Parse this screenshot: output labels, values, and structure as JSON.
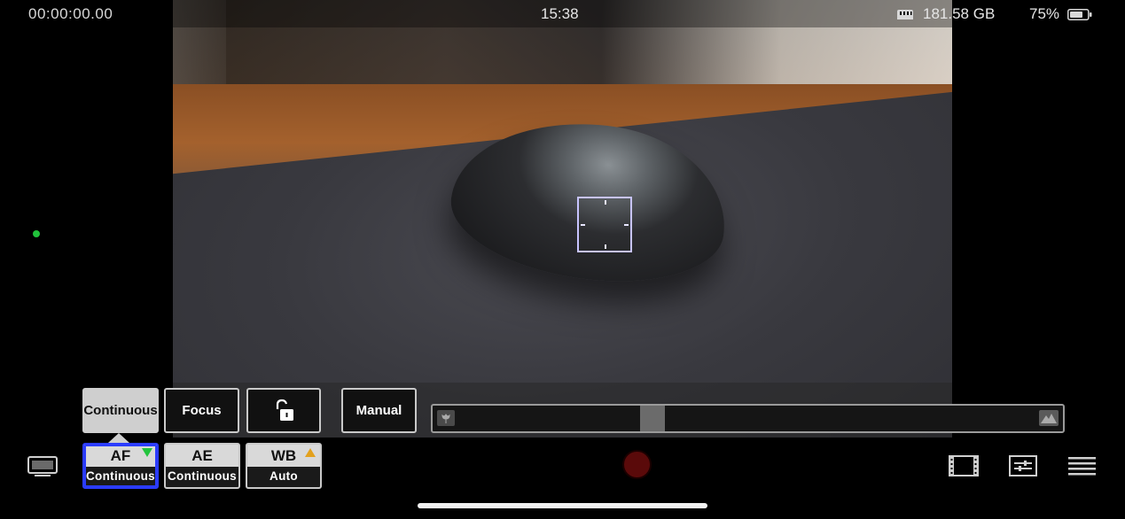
{
  "status": {
    "timecode": "00:00:00.00",
    "clock": "15:38",
    "storage": "181.58 GB",
    "battery": "75%",
    "storage_icon": "sd-card-icon",
    "battery_icon": "battery-icon",
    "battery_level_fraction": 0.75
  },
  "focus_options": {
    "continuous": "Continuous",
    "focus": "Focus",
    "lock_icon": "unlock-icon",
    "manual": "Manual",
    "selected": "Continuous"
  },
  "focus_slider": {
    "left_icon": "macro-flower-icon",
    "right_icon": "mountain-infinity-icon",
    "position_fraction": 0.35
  },
  "modes": [
    {
      "top": "AF",
      "bottom": "Continuous",
      "indicator": "green-triangle",
      "active": true
    },
    {
      "top": "AE",
      "bottom": "Continuous",
      "indicator": "",
      "active": false
    },
    {
      "top": "WB",
      "bottom": "Auto",
      "indicator": "warning-triangle",
      "active": false
    }
  ],
  "toolbar": {
    "monitor_icon": "monitor-icon",
    "record_icon": "record-button",
    "film_icon": "film-frame-icon",
    "adjust_icon": "sliders-icon",
    "menu_icon": "menu-icon"
  },
  "colors": {
    "active_outline": "#2b3cff",
    "record": "#5a0a0a",
    "status_dot": "#21c23b",
    "warning": "#e3a11d",
    "focus_box": "#c8c4ff"
  }
}
